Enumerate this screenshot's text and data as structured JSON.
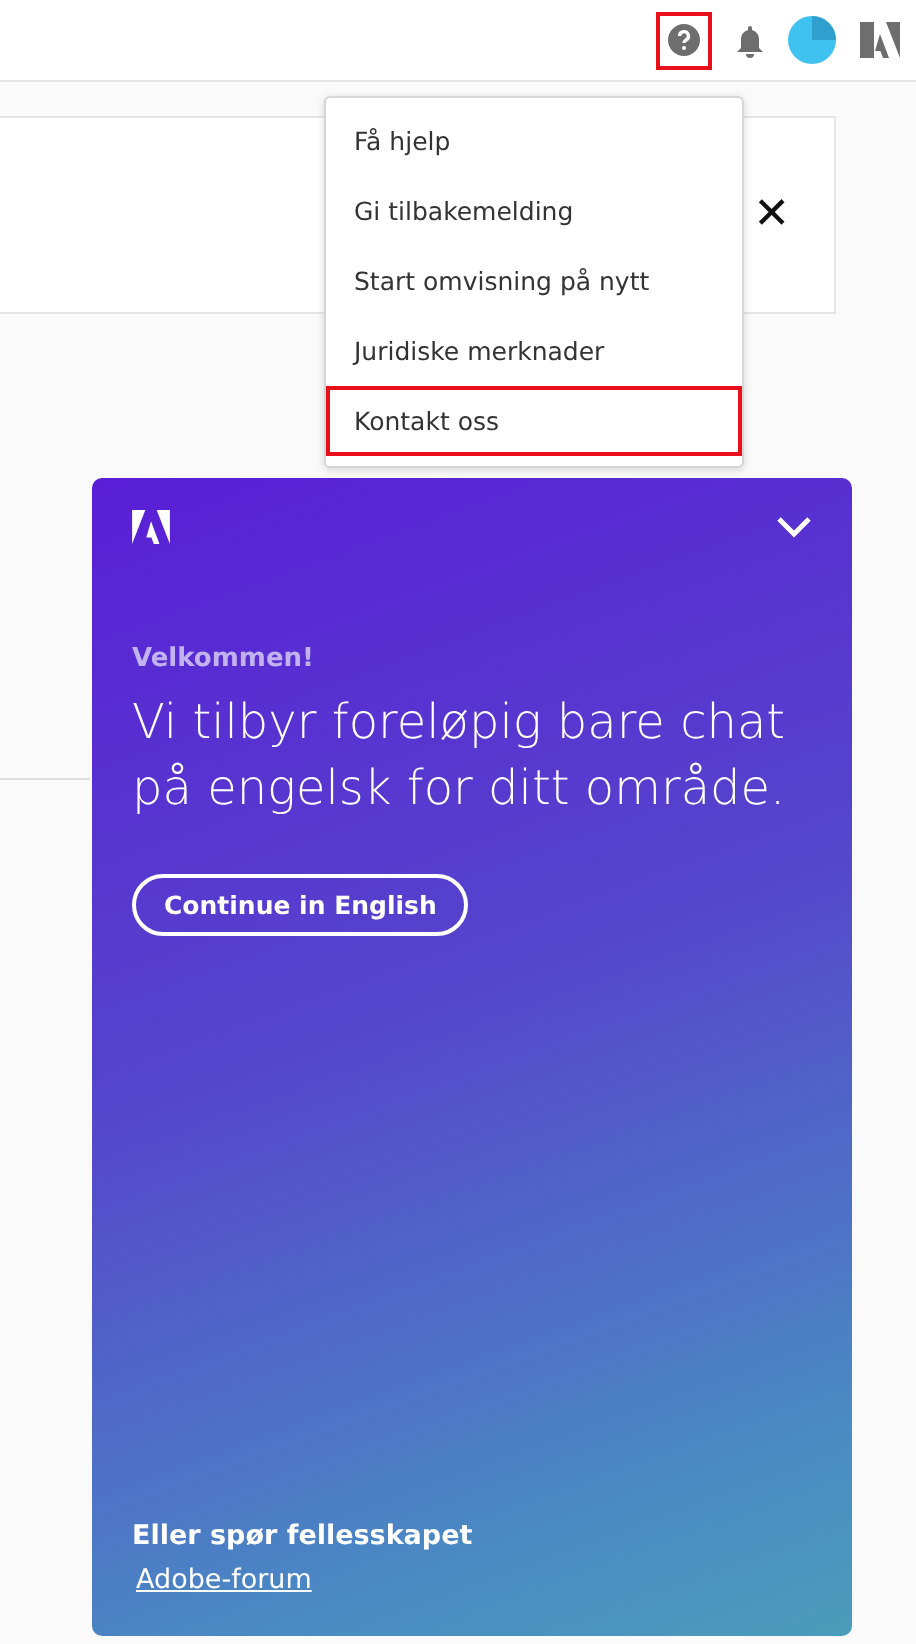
{
  "top_bar": {
    "help_button": {
      "highlighted": true
    }
  },
  "notice_card": {
    "close": "✕"
  },
  "help_menu": {
    "items": [
      {
        "label": "Få hjelp",
        "highlighted": false
      },
      {
        "label": "Gi tilbakemelding",
        "highlighted": false
      },
      {
        "label": "Start omvisning på nytt",
        "highlighted": false
      },
      {
        "label": "Juridiske merknader",
        "highlighted": false
      },
      {
        "label": "Kontakt oss",
        "highlighted": true
      }
    ]
  },
  "chat_panel": {
    "greeting": "Velkommen!",
    "message": "Vi tilbyr foreløpig bare chat på engelsk for ditt område.",
    "button": "Continue in English",
    "community_heading": "Eller spør fellesskapet",
    "community_link": "Adobe-forum"
  }
}
